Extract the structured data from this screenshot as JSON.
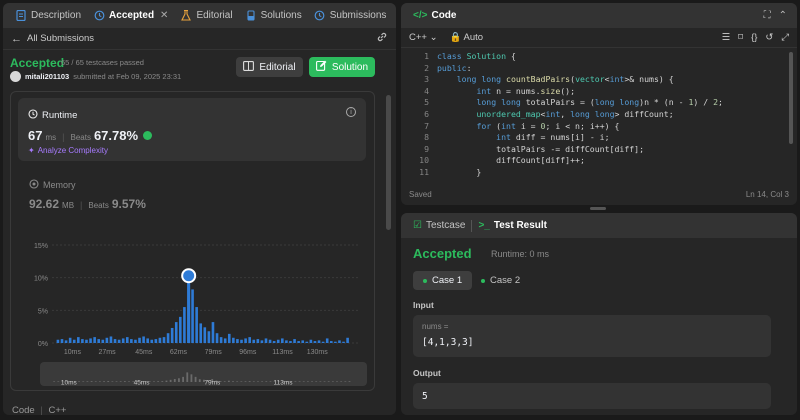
{
  "left_tabs": [
    {
      "label": "Description",
      "icon": "document-icon"
    },
    {
      "label": "Accepted",
      "icon": "history-icon",
      "active": true
    },
    {
      "label": "Editorial",
      "icon": "flask-icon"
    },
    {
      "label": "Solutions",
      "icon": "beaker-icon"
    },
    {
      "label": "Submissions",
      "icon": "clock-icon"
    }
  ],
  "subbar": {
    "back_label": "All Submissions"
  },
  "submission": {
    "status": "Accepted",
    "testcases": "65 / 65 testcases passed",
    "username": "mitali201103",
    "submitted": "submitted at Feb 09, 2025 23:31",
    "editorial_btn": "Editorial",
    "solution_btn": "Solution"
  },
  "runtime": {
    "title": "Runtime",
    "value": "67",
    "unit": "ms",
    "beats_label": "Beats",
    "beats": "67.78%",
    "analyze": "Analyze Complexity"
  },
  "memory": {
    "title": "Memory",
    "value": "92.62",
    "unit": "MB",
    "beats_label": "Beats",
    "beats": "9.57%"
  },
  "chart_data": {
    "type": "bar",
    "ylabels": [
      "15%",
      "10%",
      "5%",
      "0%"
    ],
    "yticks": [
      15,
      10,
      5,
      0
    ],
    "ylim": [
      0,
      15
    ],
    "xlabels": [
      "10ms",
      "27ms",
      "45ms",
      "62ms",
      "79ms",
      "96ms",
      "113ms",
      "130ms"
    ],
    "xticks": [
      10,
      27,
      45,
      62,
      79,
      96,
      113,
      130
    ],
    "xlim": [
      0,
      150
    ],
    "marker": {
      "x": 67,
      "y": 10.3
    },
    "bars": [
      [
        3,
        0.5
      ],
      [
        5,
        0.6
      ],
      [
        7,
        0.4
      ],
      [
        9,
        0.8
      ],
      [
        11,
        0.5
      ],
      [
        13,
        0.9
      ],
      [
        15,
        0.6
      ],
      [
        17,
        0.5
      ],
      [
        19,
        0.7
      ],
      [
        21,
        0.9
      ],
      [
        23,
        0.6
      ],
      [
        25,
        0.5
      ],
      [
        27,
        0.8
      ],
      [
        29,
        1.0
      ],
      [
        31,
        0.6
      ],
      [
        33,
        0.5
      ],
      [
        35,
        0.7
      ],
      [
        37,
        0.9
      ],
      [
        39,
        0.6
      ],
      [
        41,
        0.5
      ],
      [
        43,
        0.8
      ],
      [
        45,
        1.0
      ],
      [
        47,
        0.7
      ],
      [
        49,
        0.5
      ],
      [
        51,
        0.6
      ],
      [
        53,
        0.8
      ],
      [
        55,
        0.9
      ],
      [
        57,
        1.5
      ],
      [
        59,
        2.3
      ],
      [
        61,
        3.2
      ],
      [
        63,
        4.0
      ],
      [
        65,
        5.5
      ],
      [
        67,
        10.3
      ],
      [
        69,
        8.2
      ],
      [
        71,
        5.5
      ],
      [
        73,
        3.0
      ],
      [
        75,
        2.4
      ],
      [
        77,
        1.8
      ],
      [
        79,
        3.2
      ],
      [
        81,
        1.5
      ],
      [
        83,
        0.9
      ],
      [
        85,
        0.7
      ],
      [
        87,
        1.4
      ],
      [
        89,
        0.8
      ],
      [
        91,
        0.6
      ],
      [
        93,
        0.5
      ],
      [
        95,
        0.7
      ],
      [
        97,
        0.9
      ],
      [
        99,
        0.5
      ],
      [
        101,
        0.6
      ],
      [
        103,
        0.4
      ],
      [
        105,
        0.7
      ],
      [
        107,
        0.5
      ],
      [
        109,
        0.3
      ],
      [
        111,
        0.5
      ],
      [
        113,
        0.7
      ],
      [
        115,
        0.4
      ],
      [
        117,
        0.3
      ],
      [
        119,
        0.6
      ],
      [
        121,
        0.3
      ],
      [
        123,
        0.4
      ],
      [
        125,
        0.2
      ],
      [
        127,
        0.5
      ],
      [
        129,
        0.3
      ],
      [
        131,
        0.4
      ],
      [
        133,
        0.2
      ],
      [
        135,
        0.7
      ],
      [
        137,
        0.3
      ],
      [
        139,
        0.2
      ],
      [
        141,
        0.4
      ],
      [
        143,
        0.2
      ],
      [
        145,
        0.8
      ]
    ],
    "mini_labels": [
      "10ms",
      "45ms",
      "79ms",
      "113ms"
    ],
    "mini_ticks": [
      10,
      45,
      79,
      113
    ]
  },
  "footer": {
    "code_label": "Code",
    "lang_label": "C++"
  },
  "code_panel": {
    "title": "Code",
    "language": "C++",
    "mode": "Auto",
    "status": "Saved",
    "cursor": "Ln 14, Col 3",
    "lines": [
      "class Solution {",
      "public:",
      "    long long countBadPairs(vector<int>& nums) {",
      "        int n = nums.size();",
      "        long long totalPairs = (long long)n * (n - 1) / 2;",
      "        unordered_map<int, long long> diffCount;",
      "        for (int i = 0; i < n; i++) {",
      "            int diff = nums[i] - i;",
      "            totalPairs -= diffCount[diff];",
      "            diffCount[diff]++;",
      "        }"
    ]
  },
  "result_panel": {
    "tab_testcase": "Testcase",
    "tab_result": "Test Result",
    "status": "Accepted",
    "runtime": "Runtime: 0 ms",
    "cases": [
      "Case 1",
      "Case 2"
    ],
    "input_label": "Input",
    "input_name": "nums =",
    "input_value": "[4,1,3,3]",
    "output_label": "Output",
    "output_value": "5"
  },
  "colors": {
    "accent_green": "#2cbb5d",
    "bar_blue": "#2e7bd6",
    "marker": "#ffffff"
  }
}
